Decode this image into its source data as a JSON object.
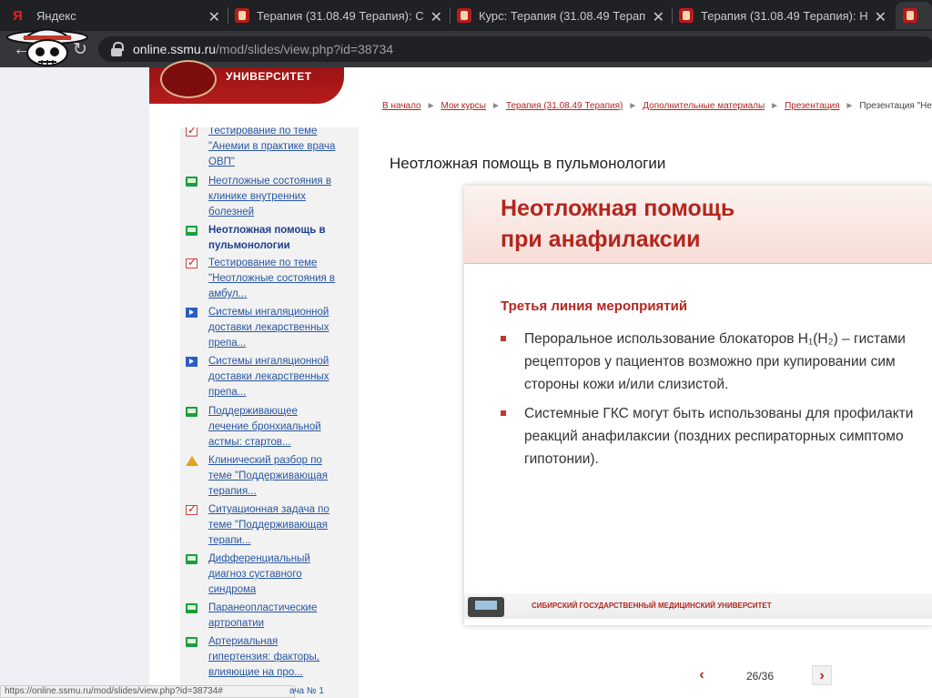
{
  "browser": {
    "tabs": [
      {
        "title": "Яндекс",
        "icon": "yandex-icon"
      },
      {
        "title": "Терапия (31.08.49 Терапия): С",
        "icon": "ssmu-favicon"
      },
      {
        "title": "Курс: Терапия (31.08.49 Терап",
        "icon": "ssmu-favicon"
      },
      {
        "title": "Терапия (31.08.49 Терапия): Н",
        "icon": "ssmu-favicon"
      }
    ],
    "url_host": "online.ssmu.ru",
    "url_path": "/mod/slides/view.php?id=38734",
    "close_glyph": "✕"
  },
  "site": {
    "logo_text": "УНИВЕРСИТЕТ",
    "breadcrumbs": [
      "В начало",
      "Мои курсы",
      "Терапия (31.08.49 Терапия)",
      "Дополнительные материалы",
      "Презентация",
      "Презентация \"Неот"
    ],
    "breadcrumb_separator": "►"
  },
  "sidebar": {
    "items": [
      {
        "lines": [
          "Тестирование по теме",
          "\"Анемии в практике врача",
          "ОВП\""
        ],
        "icon": "test"
      },
      {
        "lines": [
          "Неотложные состояния в",
          "клинике внутренних",
          "болезней"
        ],
        "icon": "slides"
      },
      {
        "lines": [
          "Неотложная помощь в",
          "пульмонологии"
        ],
        "icon": "slides",
        "current": true
      },
      {
        "lines": [
          "Тестирование по теме",
          "\"Неотложные состояния в",
          "амбул..."
        ],
        "icon": "test"
      },
      {
        "lines": [
          "Системы ингаляционной",
          "доставки лекарственных",
          "препа..."
        ],
        "icon": "video"
      },
      {
        "lines": [
          "Системы ингаляционной",
          "доставки лекарственных",
          "препа..."
        ],
        "icon": "video"
      },
      {
        "lines": [
          "Поддерживающее",
          "лечение бронхиальной",
          "астмы: стартов..."
        ],
        "icon": "slides"
      },
      {
        "lines": [
          "Клинический разбор по",
          "теме \"Поддерживающая",
          "терапия..."
        ],
        "icon": "case"
      },
      {
        "lines": [
          "Ситуационная задача по",
          "теме \"Поддерживающая",
          "терапи..."
        ],
        "icon": "test"
      },
      {
        "lines": [
          "Дифференциальный",
          "диагноз суставного",
          "синдрома"
        ],
        "icon": "slides"
      },
      {
        "lines": [
          "Паранеопластические",
          "артропатии"
        ],
        "icon": "slides"
      },
      {
        "lines": [
          "Артериальная",
          "гипертензия: факторы,",
          "влияющие на про..."
        ],
        "icon": "slides"
      },
      {
        "lines": [
          "ача № 1"
        ],
        "icon": "test"
      }
    ]
  },
  "main": {
    "title": "Неотложная помощь в пульмонологии",
    "slide": {
      "heading_lines": [
        "Неотложная помощь",
        "при анафилаксии"
      ],
      "subheading": "Третья линия мероприятий",
      "bullets": [
        [
          "Пероральное использование блокаторов H₁(H₂) – гистами",
          "рецепторов у пациентов возможно при купировании сим",
          "стороны кожи и/или слизистой."
        ],
        [
          "Системные ГКС могут быть использованы для профилакти",
          "реакций анафилаксии (поздних респираторных симптомо",
          "гипотонии)."
        ]
      ],
      "footer_text": "СИБИРСКИЙ ГОСУДАРСТВЕННЫЙ МЕДИЦИНСКИЙ УНИВЕРСИТЕТ"
    },
    "pager": {
      "current": 26,
      "total": 36,
      "text": "26/36",
      "prev": "‹",
      "next": "›"
    }
  },
  "status_url": "https://online.ssmu.ru/mod/slides/view.php?id=38734#"
}
